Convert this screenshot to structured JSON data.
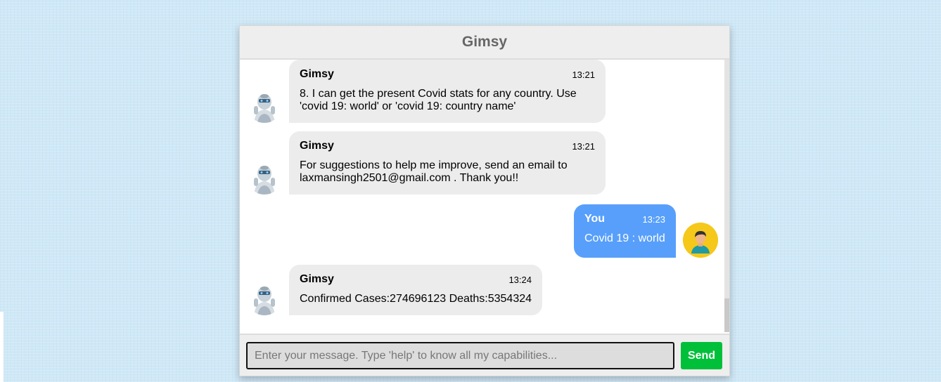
{
  "header": {
    "title": "Gimsy"
  },
  "messages": [
    {
      "side": "left",
      "sender": "Gimsy",
      "time": "13:21",
      "text": "8. I can get the present Covid stats for any country. Use 'covid 19: world' or 'covid 19: country name'",
      "avatar": "robot-icon"
    },
    {
      "side": "left",
      "sender": "Gimsy",
      "time": "13:21",
      "text": "For suggestions to help me improve, send an email to laxmansingh2501@gmail.com . Thank you!!",
      "avatar": "robot-icon"
    },
    {
      "side": "right",
      "sender": "You",
      "time": "13:23",
      "text": "Covid 19 : world",
      "avatar": "user-icon"
    },
    {
      "side": "left",
      "sender": "Gimsy",
      "time": "13:24",
      "text": "Confirmed Cases:274696123 Deaths:5354324",
      "avatar": "robot-icon"
    }
  ],
  "composer": {
    "placeholder": "Enter your message. Type 'help' to know all my capabilities...",
    "value": "",
    "send_label": "Send"
  },
  "colors": {
    "bot_bubble": "#ececec",
    "user_bubble": "#579ffb",
    "send_button": "#00c03a",
    "header_bg": "#eeeeee"
  }
}
